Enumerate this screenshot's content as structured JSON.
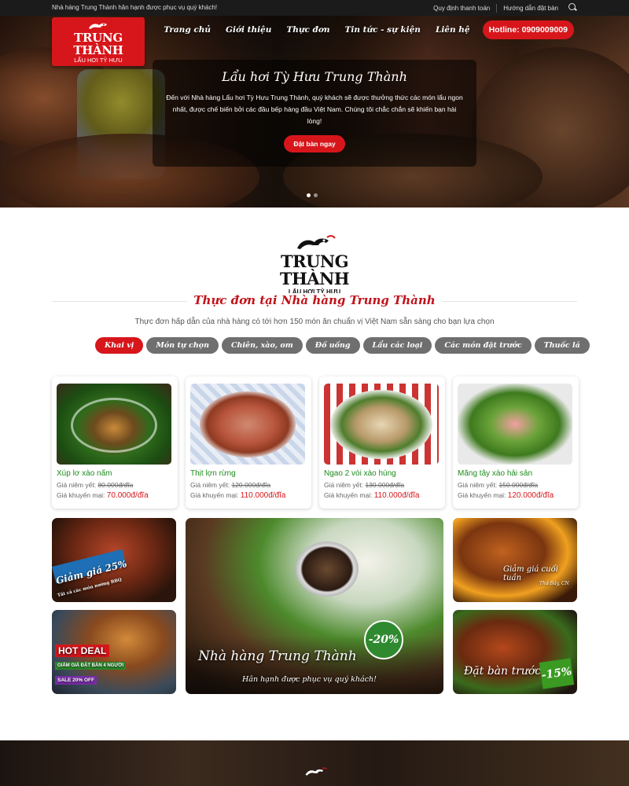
{
  "topbar": {
    "welcome": "Nhà hàng Trung Thành hân hạnh được phục vụ quý khách!",
    "links": [
      "Quy định thanh toán",
      "Hướng dẫn đặt bàn"
    ]
  },
  "logo": {
    "title": "TRUNG THÀNH",
    "subtitle": "LẨU HƠI TỶ HƯU"
  },
  "nav": {
    "items": [
      "Trang chủ",
      "Giới thiệu",
      "Thực đơn",
      "Tin tức - sự kiện",
      "Liên hệ"
    ],
    "hotline": "Hotline: 0909009009"
  },
  "hero": {
    "title": "Lẩu hơi Tỳ Hưu Trung Thành",
    "text": "Đến với Nhà hàng Lẩu hơi Tỳ Hưu Trung Thành, quý khách sẽ được thưởng thức các món lẩu ngon nhất, được chế biến bởi các đầu bếp hàng đầu Việt Nam. Chúng tôi chắc chắn sẽ khiến bạn hài lòng!",
    "button": "Đặt bàn ngay"
  },
  "section": {
    "logo_title": "TRUNG THÀNH",
    "logo_subtitle": "LẨU HƠI TỶ HƯU",
    "title": "Thực đơn tại Nhà hàng Trung Thành",
    "description": "Thực đơn hấp dẫn của nhà hàng có tới hơn 150 món ăn chuẩn vị Việt Nam sẵn sàng cho bạn lựa chọn",
    "tabs": [
      "Khai vị",
      "Món tự chọn",
      "Chiên, xào, om",
      "Đồ uống",
      "Lẩu các loại",
      "Các món đặt trước",
      "Thuốc lá"
    ],
    "active_tab": "Khai vị"
  },
  "products": [
    {
      "name": "Xúp lơ xào nấm",
      "list_label": "Giá niêm yết:",
      "list_price": "80.000đ/đĩa",
      "sale_label": "Giá khuyến mại:",
      "sale_price": "70.000đ/đĩa"
    },
    {
      "name": "Thịt lợn rừng",
      "list_label": "Giá niêm yết:",
      "list_price": "120.000đ/đĩa",
      "sale_label": "Giá khuyến mại:",
      "sale_price": "110.000đ/đĩa"
    },
    {
      "name": "Ngao 2 vòi xào húng",
      "list_label": "Giá niêm yết:",
      "list_price": "130.000đ/đĩa",
      "sale_label": "Giá khuyến mại:",
      "sale_price": "110.000đ/đĩa"
    },
    {
      "name": "Măng tây xào hải sản",
      "list_label": "Giá niêm yết:",
      "list_price": "150.000đ/đĩa",
      "sale_label": "Giá khuyến mại:",
      "sale_price": "120.000đ/đĩa"
    }
  ],
  "promos": {
    "p1_title": "Giảm giá 25%",
    "p1_sub": "Tất cả các món nướng BBQ",
    "p2_title": "HOT DEAL",
    "p2_sub": "GIẢM GIÁ ĐẶT BÀN 4 NGƯỜI",
    "p2_tag": "SALE 20% OFF",
    "center_title": "Nhà hàng Trung Thành",
    "center_sub": "Hân hạnh được phục vụ quý khách!",
    "center_badge": "-20%",
    "r1_title": "Giảm giá cuối tuần",
    "r1_sub": "Thứ Bảy, CN",
    "r2_title": "Đặt bàn trước",
    "r2_badge": "-15%"
  },
  "colors": {
    "brand": "#d7161b",
    "dish_name": "#1f8a1f",
    "topbar": "#1b1b1b"
  }
}
